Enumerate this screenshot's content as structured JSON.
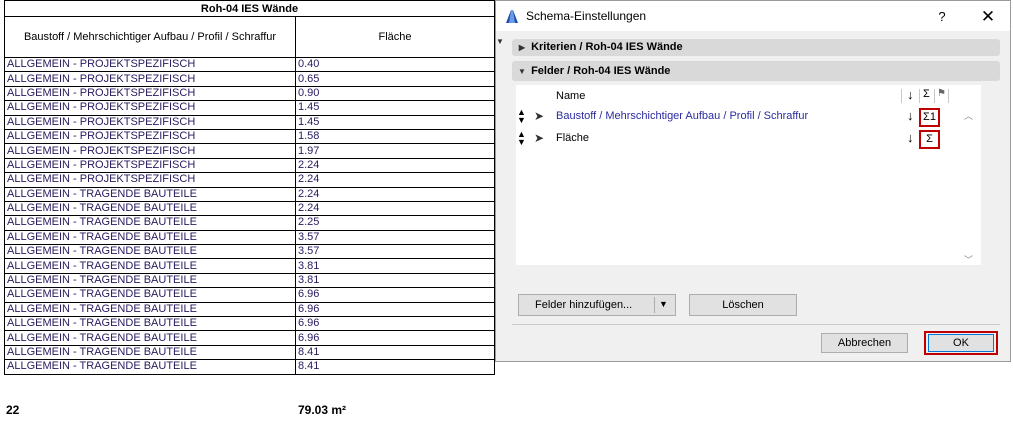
{
  "schedule": {
    "title": "Roh-04 IES Wände",
    "col1_header": "Baustoff / Mehrschichtiger Aufbau / Profil / Schraffur",
    "col2_header": "Fläche",
    "rows": [
      {
        "material": "ALLGEMEIN - PROJEKTSPEZIFISCH",
        "area": "0.40"
      },
      {
        "material": "ALLGEMEIN - PROJEKTSPEZIFISCH",
        "area": "0.65"
      },
      {
        "material": "ALLGEMEIN - PROJEKTSPEZIFISCH",
        "area": "0.90"
      },
      {
        "material": "ALLGEMEIN - PROJEKTSPEZIFISCH",
        "area": "1.45"
      },
      {
        "material": "ALLGEMEIN - PROJEKTSPEZIFISCH",
        "area": "1.45"
      },
      {
        "material": "ALLGEMEIN - PROJEKTSPEZIFISCH",
        "area": "1.58"
      },
      {
        "material": "ALLGEMEIN - PROJEKTSPEZIFISCH",
        "area": "1.97"
      },
      {
        "material": "ALLGEMEIN - PROJEKTSPEZIFISCH",
        "area": "2.24"
      },
      {
        "material": "ALLGEMEIN - PROJEKTSPEZIFISCH",
        "area": "2.24"
      },
      {
        "material": "ALLGEMEIN - TRAGENDE BAUTEILE",
        "area": "2.24"
      },
      {
        "material": "ALLGEMEIN - TRAGENDE BAUTEILE",
        "area": "2.24"
      },
      {
        "material": "ALLGEMEIN - TRAGENDE BAUTEILE",
        "area": "2.25"
      },
      {
        "material": "ALLGEMEIN - TRAGENDE BAUTEILE",
        "area": "3.57"
      },
      {
        "material": "ALLGEMEIN - TRAGENDE BAUTEILE",
        "area": "3.57"
      },
      {
        "material": "ALLGEMEIN - TRAGENDE BAUTEILE",
        "area": "3.81"
      },
      {
        "material": "ALLGEMEIN - TRAGENDE BAUTEILE",
        "area": "3.81"
      },
      {
        "material": "ALLGEMEIN - TRAGENDE BAUTEILE",
        "area": "6.96"
      },
      {
        "material": "ALLGEMEIN - TRAGENDE BAUTEILE",
        "area": "6.96"
      },
      {
        "material": "ALLGEMEIN - TRAGENDE BAUTEILE",
        "area": "6.96"
      },
      {
        "material": "ALLGEMEIN - TRAGENDE BAUTEILE",
        "area": "6.96"
      },
      {
        "material": "ALLGEMEIN - TRAGENDE BAUTEILE",
        "area": "8.41"
      },
      {
        "material": "ALLGEMEIN - TRAGENDE BAUTEILE",
        "area": "8.41"
      }
    ],
    "summary_count": "22",
    "summary_area": "79.03 m²"
  },
  "dialog": {
    "title": "Schema-Einstellungen",
    "help_label": "?",
    "close_label": "✕",
    "criteria_section": "Kriterien / Roh-04 IES Wände",
    "fields_section": "Felder / Roh-04 IES Wände",
    "field_list": {
      "name_header": "Name",
      "sort_header": "↓",
      "sum_header": "Σ",
      "fields": [
        {
          "name": "Baustoff / Mehrschichtiger Aufbau / Profil / Schraffur",
          "sort": "↓",
          "sum": "Σ1"
        },
        {
          "name": "Fläche",
          "sort": "↓",
          "sum": "Σ"
        }
      ]
    },
    "add_fields_label": "Felder hinzufügen...",
    "delete_label": "Löschen",
    "cancel_label": "Abbrechen",
    "ok_label": "OK"
  },
  "colors": {
    "highlight_red": "#c00000",
    "field_link_blue": "#2a2aa0",
    "section_gray": "#d9d9d9"
  }
}
